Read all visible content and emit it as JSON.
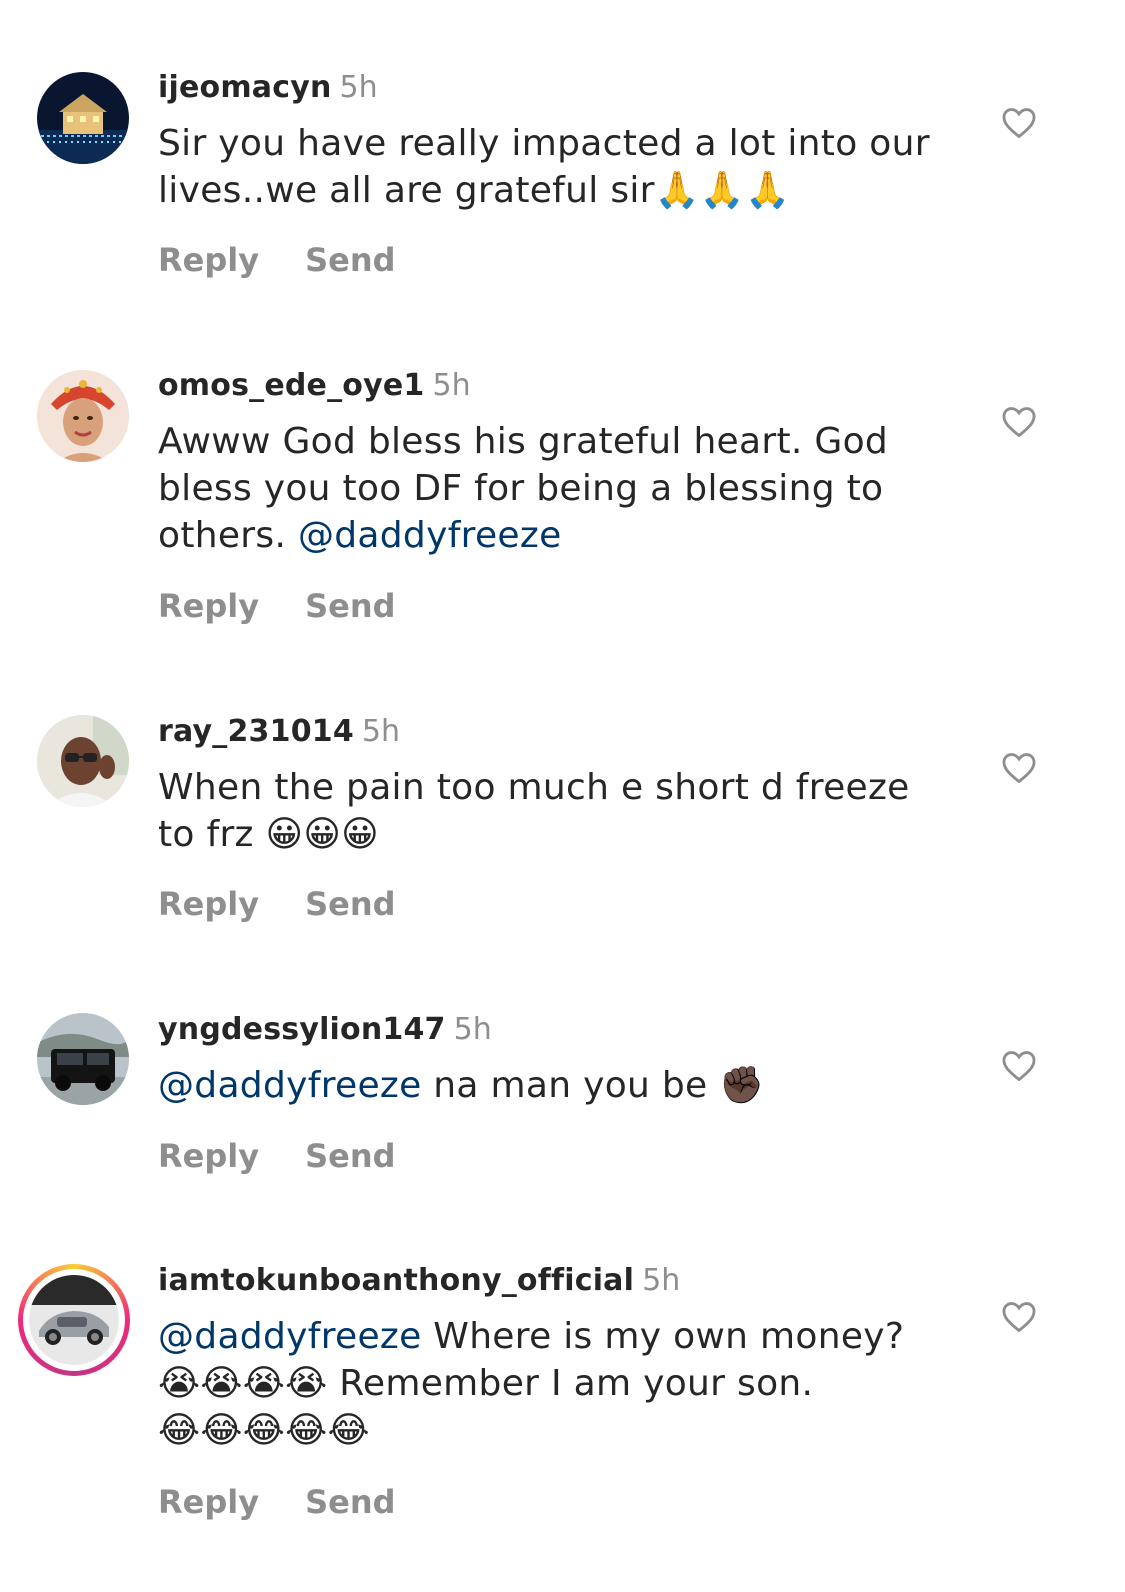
{
  "comments": [
    {
      "username": "ijeomacyn",
      "time": "5h",
      "text": "Sir you have really impacted a lot into our lives..we all are grateful sir",
      "emojis": "🙏🙏🙏",
      "reply_label": "Reply",
      "send_label": "Send"
    },
    {
      "username": "omos_ede_oye1",
      "time": "5h",
      "text": "Awww God bless his grateful heart. God bless you too DF for being a blessing to others.",
      "mention": "@daddyfreeze",
      "reply_label": "Reply",
      "send_label": "Send"
    },
    {
      "username": "ray_231014",
      "time": "5h",
      "text": "When the pain too much e short d freeze to frz",
      "emojis": "😀😀😀",
      "reply_label": "Reply",
      "send_label": "Send"
    },
    {
      "username": "yngdessylion147",
      "time": "5h",
      "mention": "@daddyfreeze",
      "text": "na man you be",
      "emojis": "✊🏿",
      "reply_label": "Reply",
      "send_label": "Send"
    },
    {
      "username": "iamtokunboanthony_official",
      "time": "5h",
      "mention": "@daddyfreeze",
      "text": "Where is my own money?",
      "emojis_a": "😭😭😭😭",
      "text_b": "Remember I am your son.",
      "emojis_b": "😂😂😂😂😂",
      "reply_label": "Reply",
      "send_label": "Send"
    }
  ],
  "colors": {
    "text": "#262626",
    "secondary": "#8e8e8e",
    "mention": "#00376b"
  },
  "icons": {
    "like": "heart-outline-icon"
  }
}
